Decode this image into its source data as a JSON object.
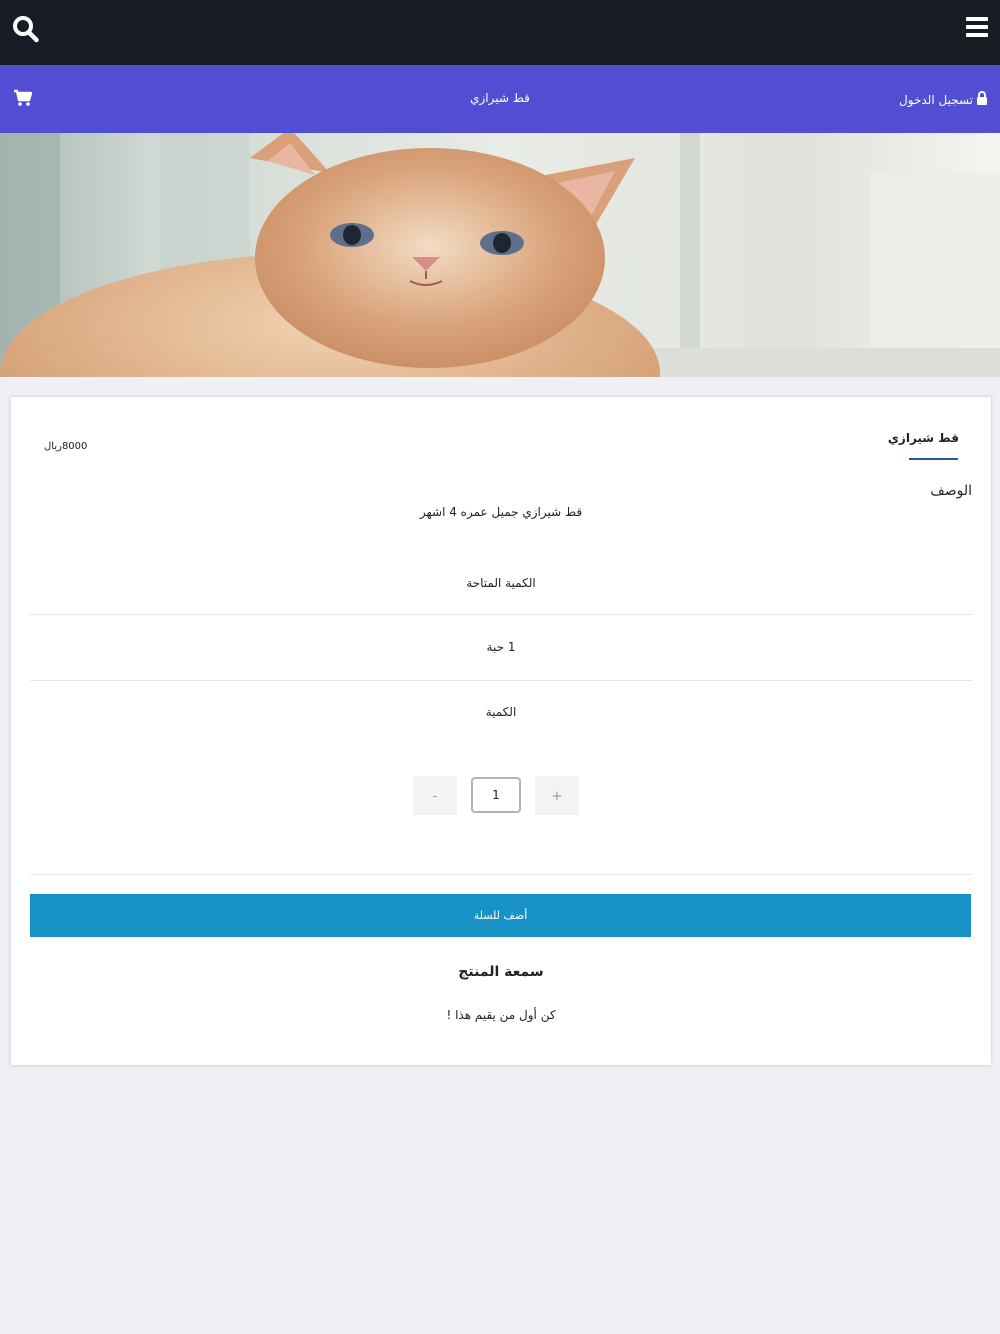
{
  "header": {
    "search_icon": "search-icon",
    "menu_icon": "hamburger-menu-icon"
  },
  "subheader": {
    "title": "قط شيرازي",
    "login_label": "تسجيل الدخول",
    "cart_icon": "shopping-cart-icon",
    "lock_icon": "lock-icon",
    "background_color": "#524ed3"
  },
  "product": {
    "name": "قط شيرازي",
    "price": "8000ريال",
    "description_label": "الوصف",
    "description": "قط شيرازي جميل عمره 4 اشهر",
    "available_quantity_label": "الكمية المتاحة",
    "available_quantity_value": "1 حبة",
    "quantity_label": "الكمية",
    "quantity_value": "1",
    "increment_label": "+",
    "decrement_label": "-",
    "add_to_cart_label": "أضف للسلة",
    "add_to_cart_color": "#1892c6"
  },
  "rating": {
    "title": "سمعة المنتج",
    "empty_text": "كن أول من يقيم هذا !"
  }
}
